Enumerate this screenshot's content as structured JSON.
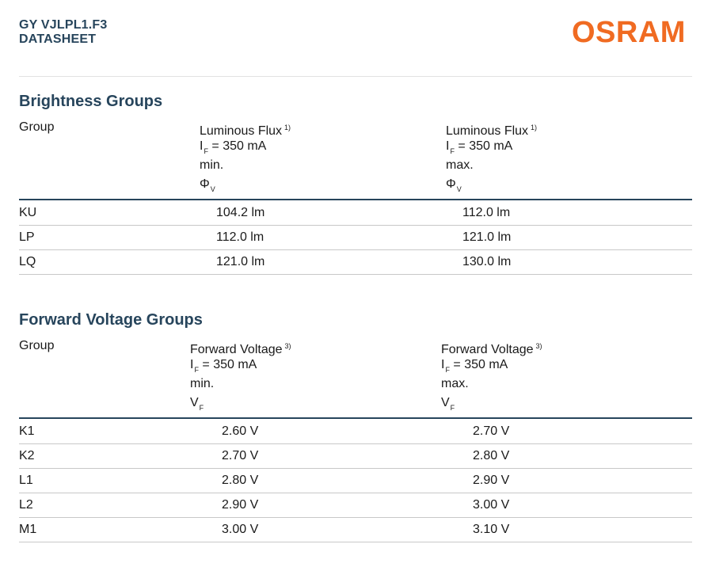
{
  "header": {
    "part_number": "GY VJLPL1.F3",
    "doc_type": "DATASHEET",
    "logo_text": "OSRAM",
    "logo_color": "#f06b22",
    "heading_color": "#27455c"
  },
  "brightness": {
    "title": "Brightness Groups",
    "columns": [
      {
        "lines": [
          "Group"
        ]
      },
      {
        "label": "Luminous Flux",
        "note": "1)",
        "cond_symbol": "I",
        "cond_sub": "F",
        "cond_value": "= 350 mA",
        "limit": "min.",
        "symbol": "Φ",
        "symbol_sub": "V"
      },
      {
        "label": "Luminous Flux",
        "note": "1)",
        "cond_symbol": "I",
        "cond_sub": "F",
        "cond_value": "= 350 mA",
        "limit": "max.",
        "symbol": "Φ",
        "symbol_sub": "V"
      }
    ],
    "rows": [
      [
        "KU",
        "104.2 lm",
        "112.0 lm"
      ],
      [
        "LP",
        "112.0 lm",
        "121.0 lm"
      ],
      [
        "LQ",
        "121.0 lm",
        "130.0 lm"
      ]
    ]
  },
  "voltage": {
    "title": "Forward Voltage Groups",
    "columns": [
      {
        "lines": [
          "Group"
        ]
      },
      {
        "label": "Forward Voltage",
        "note": "3)",
        "cond_symbol": "I",
        "cond_sub": "F",
        "cond_value": "= 350 mA",
        "limit": "min.",
        "symbol": "V",
        "symbol_sub": "F"
      },
      {
        "label": "Forward Voltage",
        "note": "3)",
        "cond_symbol": "I",
        "cond_sub": "F",
        "cond_value": "= 350 mA",
        "limit": "max.",
        "symbol": "V",
        "symbol_sub": "F"
      }
    ],
    "rows": [
      [
        "K1",
        "2.60 V",
        "2.70 V"
      ],
      [
        "K2",
        "2.70 V",
        "2.80 V"
      ],
      [
        "L1",
        "2.80 V",
        "2.90 V"
      ],
      [
        "L2",
        "2.90 V",
        "3.00 V"
      ],
      [
        "M1",
        "3.00 V",
        "3.10 V"
      ]
    ]
  }
}
